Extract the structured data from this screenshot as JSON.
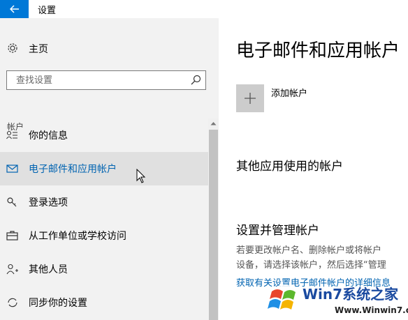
{
  "window": {
    "title": "设置"
  },
  "sidebar": {
    "home_label": "主页",
    "search": {
      "placeholder": "查找设置"
    },
    "section_label": "帐户",
    "items": [
      {
        "label": "你的信息",
        "icon": "person-info-icon",
        "selected": false
      },
      {
        "label": "电子邮件和应用帐户",
        "icon": "mail-icon",
        "selected": true
      },
      {
        "label": "登录选项",
        "icon": "key-icon",
        "selected": false
      },
      {
        "label": "从工作单位或学校访问",
        "icon": "briefcase-icon",
        "selected": false
      },
      {
        "label": "其他人员",
        "icon": "add-person-icon",
        "selected": false
      },
      {
        "label": "同步你的设置",
        "icon": "sync-icon",
        "selected": false
      }
    ]
  },
  "main": {
    "title": "电子邮件和应用帐户",
    "add_account_label": "添加帐户",
    "other_apps_heading": "其他应用使用的帐户",
    "manage_heading": "设置并管理帐户",
    "manage_desc_line1": "若要更改帐户名、删除帐户或将帐户",
    "manage_desc_line2": "设备，请选择该帐户，然后选择“管理",
    "manage_link": "获取有关设置电子邮件帐户的详细信息"
  },
  "watermark": {
    "title": "Win7系统之家",
    "url": "Www.Winwin7.com"
  },
  "colors": {
    "accent": "#0078d7",
    "link": "#0063b1",
    "sidebar_bg": "#f2f2f2",
    "selected_bg": "#e0e0e0"
  }
}
